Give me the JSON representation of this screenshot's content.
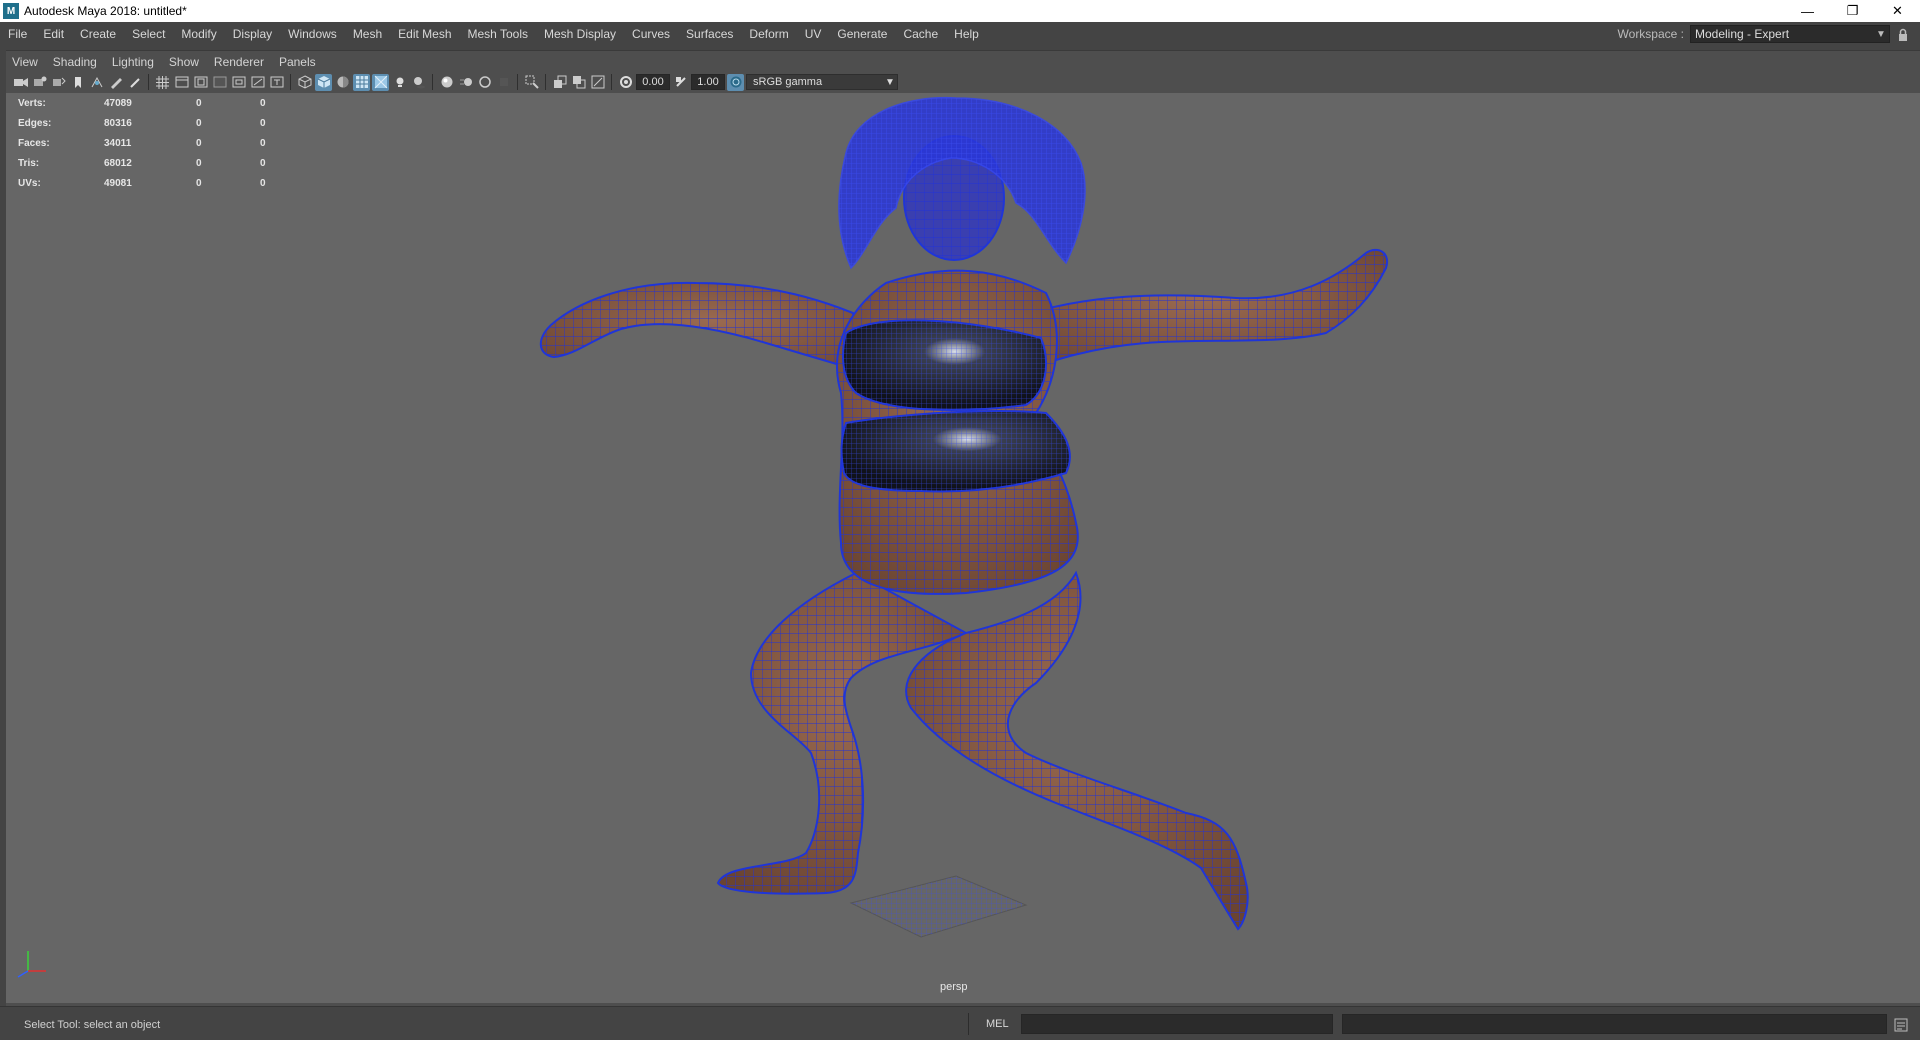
{
  "window": {
    "title": "Autodesk Maya 2018: untitled*",
    "app_icon_letter": "M",
    "minimize_glyph": "—",
    "maximize_glyph": "❐",
    "close_glyph": "✕"
  },
  "main_menu": [
    "File",
    "Edit",
    "Create",
    "Select",
    "Modify",
    "Display",
    "Windows",
    "Mesh",
    "Edit Mesh",
    "Mesh Tools",
    "Mesh Display",
    "Curves",
    "Surfaces",
    "Deform",
    "UV",
    "Generate",
    "Cache",
    "Help"
  ],
  "workspace": {
    "label": "Workspace :",
    "value": "Modeling - Expert"
  },
  "panel_menu": [
    "View",
    "Shading",
    "Lighting",
    "Show",
    "Renderer",
    "Panels"
  ],
  "toolbar": {
    "exposure_value": "0.00",
    "gamma_value": "1.00",
    "color_space": "sRGB gamma"
  },
  "hud": {
    "rows": [
      {
        "label": "Verts:",
        "v1": "47089",
        "v2": "0",
        "v3": "0"
      },
      {
        "label": "Edges:",
        "v1": "80316",
        "v2": "0",
        "v3": "0"
      },
      {
        "label": "Faces:",
        "v1": "34011",
        "v2": "0",
        "v3": "0"
      },
      {
        "label": "Tris:",
        "v1": "68012",
        "v2": "0",
        "v3": "0"
      },
      {
        "label": "UVs:",
        "v1": "49081",
        "v2": "0",
        "v3": "0"
      }
    ]
  },
  "viewport": {
    "camera": "persp",
    "wireframe_color": "#1f35d8",
    "skin_color": "#7a5440",
    "clothing_color": "#151822",
    "background": "#666666"
  },
  "status": {
    "help_line": "Select Tool: select an object",
    "command_language": "MEL"
  }
}
